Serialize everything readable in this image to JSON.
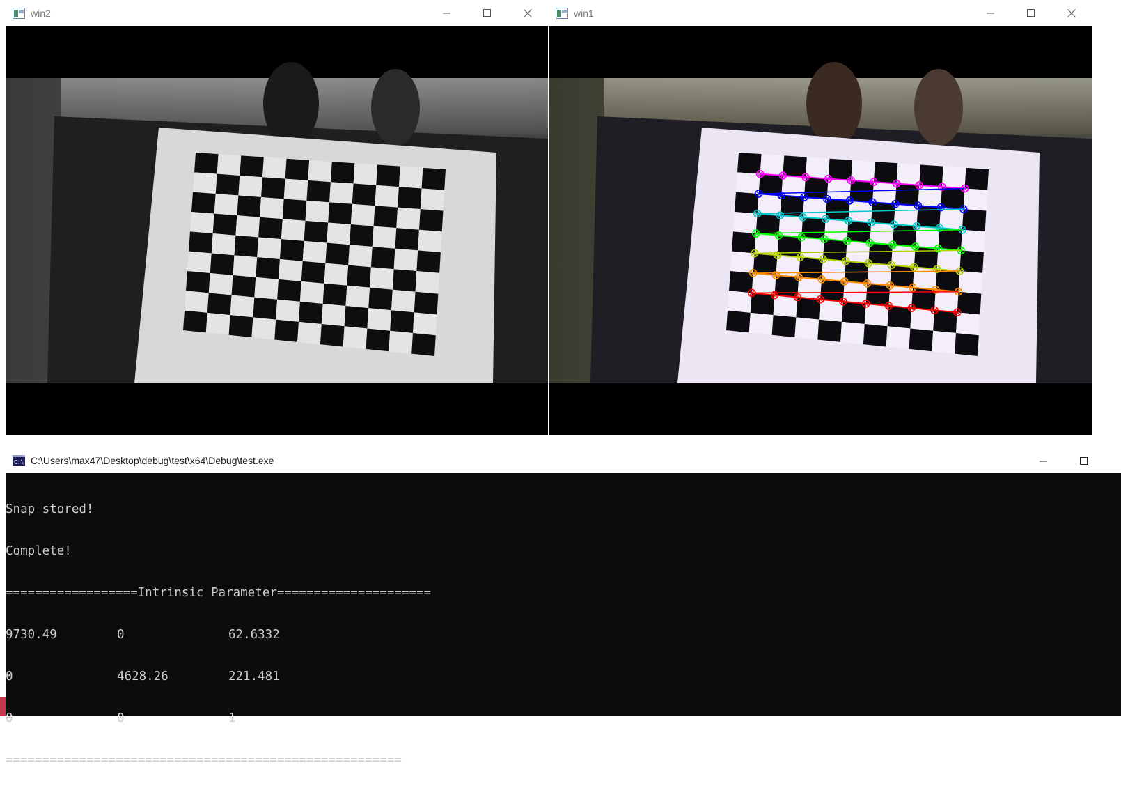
{
  "windows": {
    "left": {
      "title": "win2"
    },
    "right": {
      "title": "win1"
    }
  },
  "console": {
    "title": "C:\\Users\\max47\\Desktop\\debug\\test\\x64\\Debug\\test.exe",
    "lines": {
      "l1": "Snap stored!",
      "l2": "Complete!",
      "l3": "==================Intrinsic Parameter=====================",
      "l7": "======================================================"
    },
    "matrix": [
      [
        "9730.49",
        "0",
        "62.6332"
      ],
      [
        "0",
        "4628.26",
        "221.481"
      ],
      [
        "0",
        "0",
        "1"
      ]
    ]
  },
  "colors": {
    "row_colors": [
      "#ff00ff",
      "#0000ff",
      "#00c8c8",
      "#00ff00",
      "#b4d200",
      "#ff8c00",
      "#ff0000"
    ]
  },
  "icons": {
    "window_app": "opencv-window-icon",
    "console_app": "console-icon",
    "minimize": "minimize-icon",
    "maximize": "maximize-icon",
    "close": "close-icon"
  }
}
